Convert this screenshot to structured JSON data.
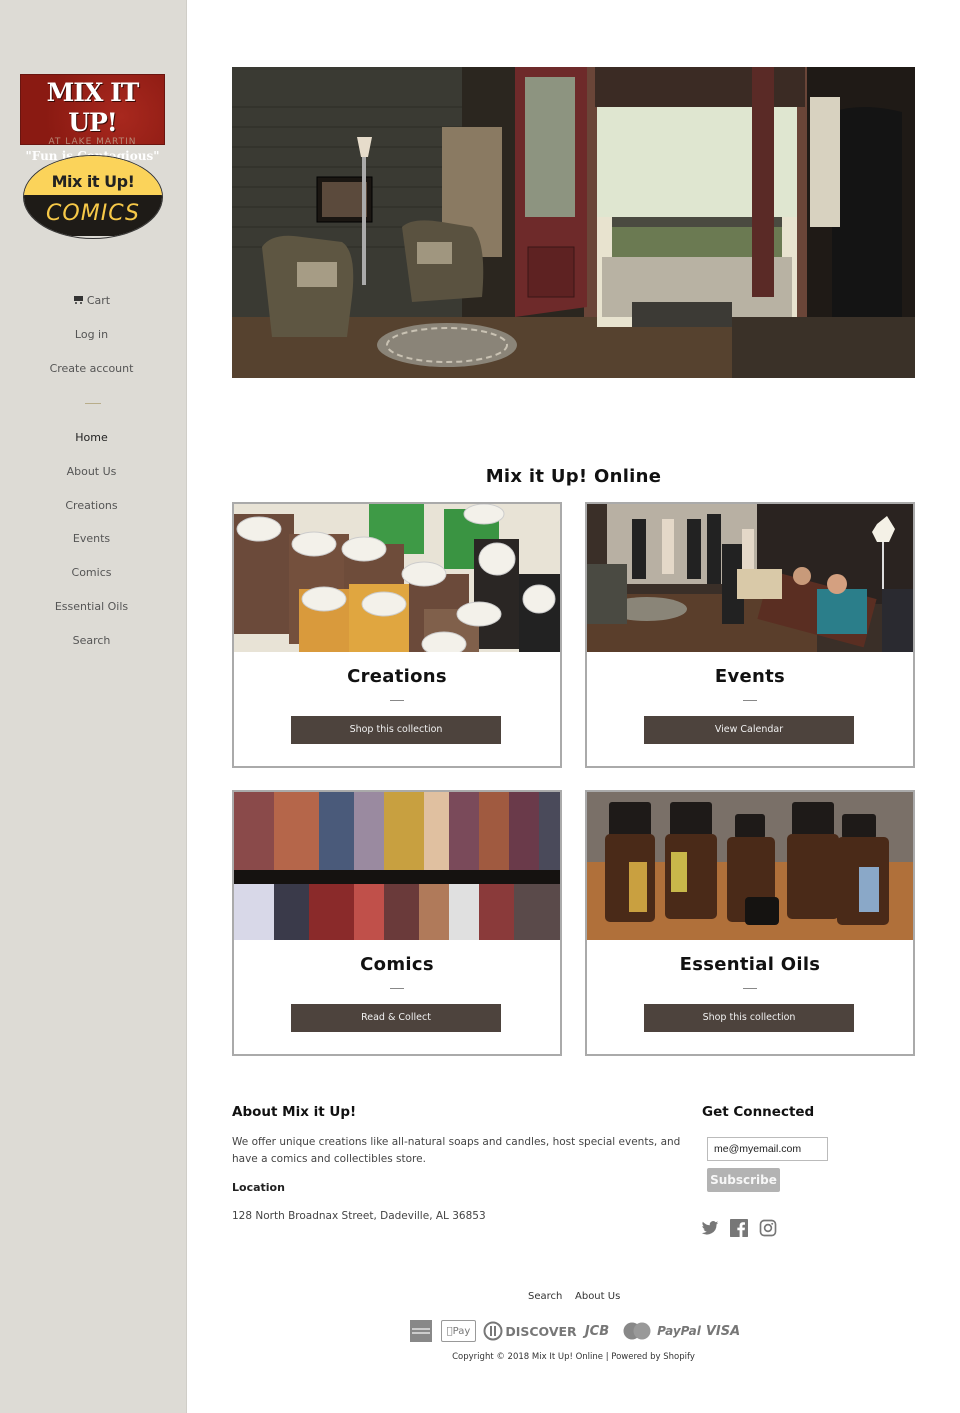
{
  "sidebar": {
    "logo_primary": {
      "line1": "MIX IT UP!",
      "line2": "AT LAKE MARTIN",
      "line3": "\"Fun is Contagious\""
    },
    "logo_secondary": {
      "top": "Mix it Up!",
      "bottom": "COMICS"
    },
    "account_links": [
      {
        "label": "Cart",
        "icon": "cart-icon"
      },
      {
        "label": "Log in"
      },
      {
        "label": "Create account"
      }
    ],
    "nav_items": [
      {
        "label": "Home",
        "active": true
      },
      {
        "label": "About Us"
      },
      {
        "label": "Creations"
      },
      {
        "label": "Events"
      },
      {
        "label": "Comics"
      },
      {
        "label": "Essential Oils"
      },
      {
        "label": "Search"
      }
    ]
  },
  "hero": {
    "alt": "Store interior with open front door"
  },
  "collections": {
    "title": "Mix it Up! Online",
    "cards": [
      {
        "title": "Creations",
        "button": "Shop this collection",
        "image": "handmade soaps"
      },
      {
        "title": "Events",
        "button": "View Calendar",
        "image": "people at store event"
      },
      {
        "title": "Comics",
        "button": "Read & Collect",
        "image": "comic book shelves"
      },
      {
        "title": "Essential Oils",
        "button": "Shop this collection",
        "image": "essential oil bottles"
      }
    ]
  },
  "footer": {
    "about": {
      "heading": "About Mix it Up!",
      "text": "We offer unique creations like all-natural soaps and candles, host special events, and have a comics and collectibles store.",
      "location_heading": "Location",
      "address": "128 North Broadnax Street, Dadeville, AL 36853"
    },
    "connect": {
      "heading": "Get Connected",
      "email_value": "me@myemail.com",
      "subscribe_label": "Subscribe",
      "social": [
        "twitter-icon",
        "facebook-icon",
        "instagram-icon"
      ]
    },
    "links": [
      "Search",
      "About Us"
    ],
    "payment_methods": [
      "American Express",
      "Apple Pay",
      "Diners Club",
      "DISCOVER",
      "JCB",
      "MasterCard",
      "PayPal",
      "VISA"
    ],
    "copyright": "Copyright © 2018 Mix It Up! Online | Powered by Shopify"
  },
  "colors": {
    "sidebar_bg": "#dddbd5",
    "button_bg": "#4d433d",
    "subscribe_bg": "#b3b3b3"
  }
}
